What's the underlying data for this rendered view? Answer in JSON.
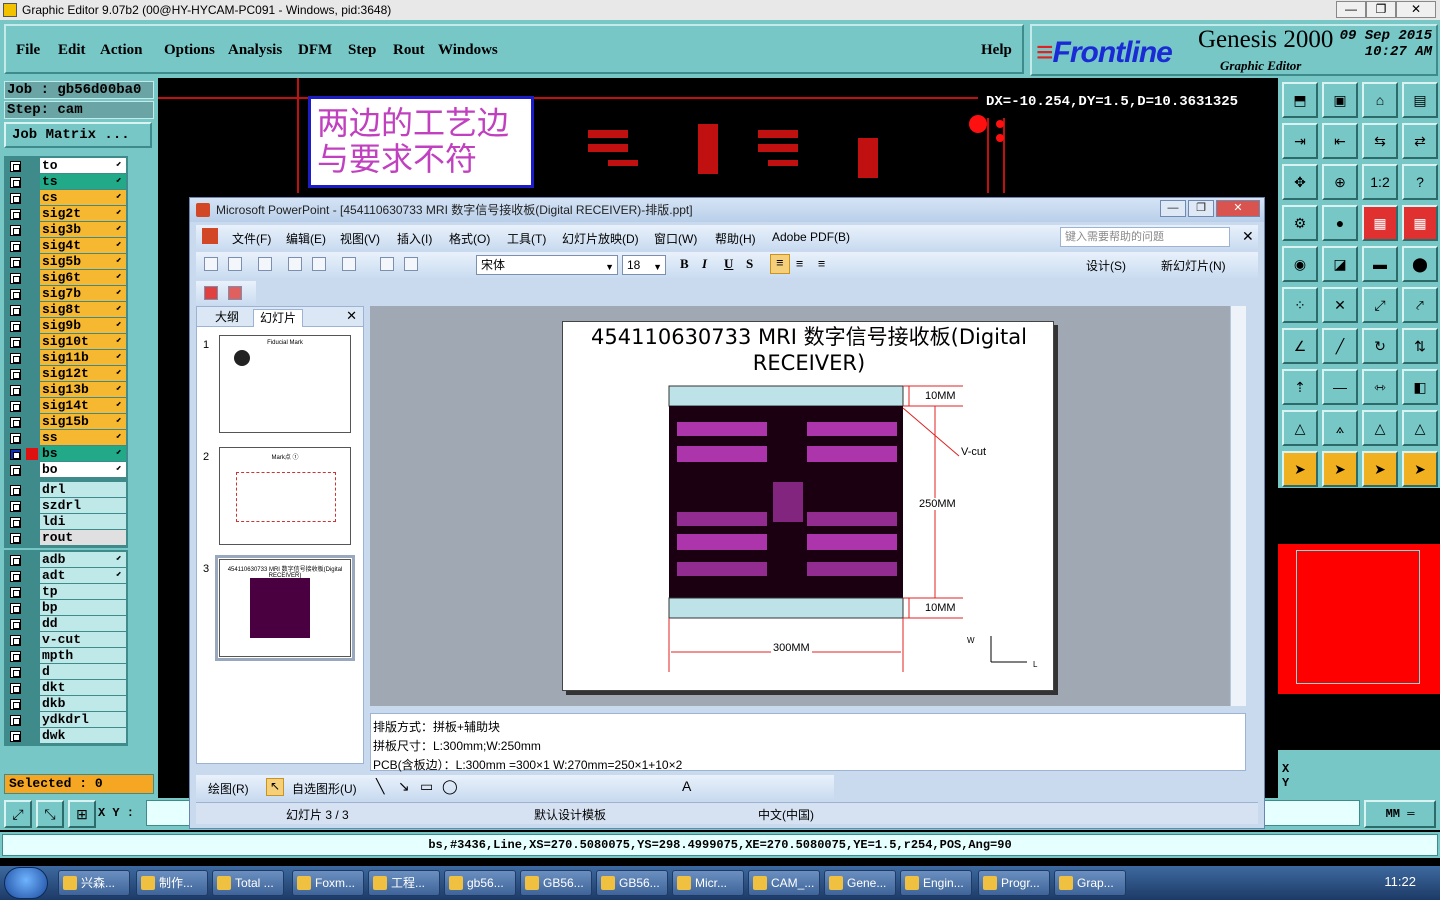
{
  "genesis": {
    "window_title": "Graphic Editor 9.07b2 (00@HY-HYCAM-PC091 - Windows, pid:3648)",
    "menu": [
      "File",
      "Edit",
      "Action",
      "Options",
      "Analysis",
      "DFM",
      "Step",
      "Rout",
      "Windows"
    ],
    "help": "Help",
    "brand": {
      "logo": "Frontline",
      "product": "Genesis 2000",
      "subtitle": "Graphic Editor",
      "date": "09 Sep 2015",
      "time": "10:27 AM"
    },
    "job": "Job  : gb56d00ba0",
    "step": "Step: cam",
    "job_matrix": "Job Matrix ...",
    "layers_group1": [
      "to",
      "ts",
      "cs",
      "sig2t",
      "sig3b",
      "sig4t",
      "sig5b",
      "sig6t",
      "sig7b",
      "sig8t",
      "sig9b",
      "sig10t",
      "sig11b",
      "sig12t",
      "sig13b",
      "sig14t",
      "sig15b",
      "ss",
      "bs",
      "bo"
    ],
    "layers_group2": [
      "drl",
      "szdrl",
      "ldi",
      "rout"
    ],
    "layers_group3": [
      "adb",
      "adt",
      "tp",
      "bp",
      "dd",
      "v-cut",
      "mpth",
      "d",
      "dkt",
      "dkb",
      "ydkdrl",
      "dwk"
    ],
    "selected": "Selected : 0",
    "note_text_line1": "两边的工艺边",
    "note_text_line2": "与要求不符",
    "dx_readout": "DX=-10.254,DY=1.5,D=10.3631325",
    "xy_label": "X Y :",
    "units": "MM",
    "status_line": "bs,#3436,Line,XS=270.5080075,YS=298.4999075,XE=270.5080075,YE=1.5,r254,POS,Ang=90",
    "xy_side_x": "X",
    "xy_side_y": "Y"
  },
  "powerpoint": {
    "title": "Microsoft PowerPoint - [454110630733 MRI 数字信号接收板(Digital RECEIVER)-排版.ppt]",
    "menu": [
      "文件(F)",
      "编辑(E)",
      "视图(V)",
      "插入(I)",
      "格式(O)",
      "工具(T)",
      "幻灯片放映(D)",
      "窗口(W)",
      "帮助(H)",
      "Adobe PDF(B)"
    ],
    "help_placeholder": "键入需要帮助的问题",
    "font_name": "宋体",
    "font_size": "18",
    "design_btn": "设计(S)",
    "new_slide_btn": "新幻灯片(N)",
    "tab_outline": "大纲",
    "tab_slides": "幻灯片",
    "thumbs": [
      {
        "num": "1",
        "title": "Fiducial Mark"
      },
      {
        "num": "2",
        "title": "Mark点 ①"
      },
      {
        "num": "3",
        "title": "454110630733 MRI 数字信号接收板(Digital RECEIVER)"
      }
    ],
    "slide_title": "454110630733 MRI 数字信号接收板(Digital RECEIVER)",
    "dims": {
      "top": "10MM",
      "vcut": "V-cut",
      "mid": "250MM",
      "bottom": "10MM",
      "width": "300MM",
      "w": "W",
      "l": "L"
    },
    "notes": [
      "排版方式：拼板+辅助块",
      "拼板尺寸：L:300mm;W:250mm",
      "PCB(含板边）：L:300mm =300×1  W:270mm=250×1+10×2"
    ],
    "draw_label": "绘图(R)",
    "autoshape_label": "自选图形(U)",
    "status_slide": "幻灯片 3 / 3",
    "status_template": "默认设计模板",
    "status_lang": "中文(中国)"
  },
  "taskbar": {
    "items": [
      "兴森...",
      "制作...",
      "Total ...",
      "Foxm...",
      "工程...",
      "gb56...",
      "GB56...",
      "GB56...",
      "Micr...",
      "CAM_...",
      "Gene...",
      "Engin...",
      "Progr...",
      "Grap..."
    ],
    "clock": "11:22"
  }
}
